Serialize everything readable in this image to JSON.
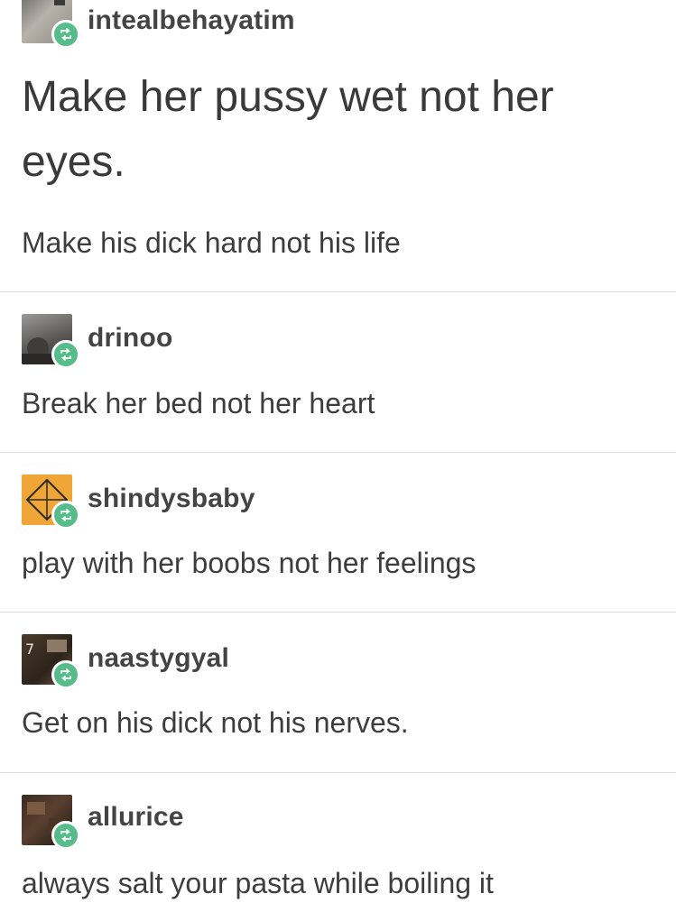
{
  "posts": [
    {
      "username": "intealbehayatim",
      "title": "Make her pussy wet not her eyes.",
      "text": "Make his dick hard not his life",
      "avatar_icon": "user-avatar",
      "badge_icon": "reblog-icon"
    },
    {
      "username": "drinoo",
      "text": "Break her bed not her heart",
      "avatar_icon": "user-avatar",
      "badge_icon": "reblog-icon"
    },
    {
      "username": "shindysbaby",
      "text": "play with her boobs not her feelings",
      "avatar_icon": "user-avatar",
      "badge_icon": "reblog-icon"
    },
    {
      "username": "naastygyal",
      "text": "Get on his dick not his nerves.",
      "avatar_icon": "user-avatar",
      "badge_icon": "reblog-icon"
    },
    {
      "username": "allurice",
      "text": "always salt your pasta while boiling it",
      "avatar_icon": "user-avatar",
      "badge_icon": "reblog-icon"
    }
  ],
  "colors": {
    "badge": "#56bc8a",
    "divider": "#dcdcdc",
    "text": "#3a3a3a"
  }
}
